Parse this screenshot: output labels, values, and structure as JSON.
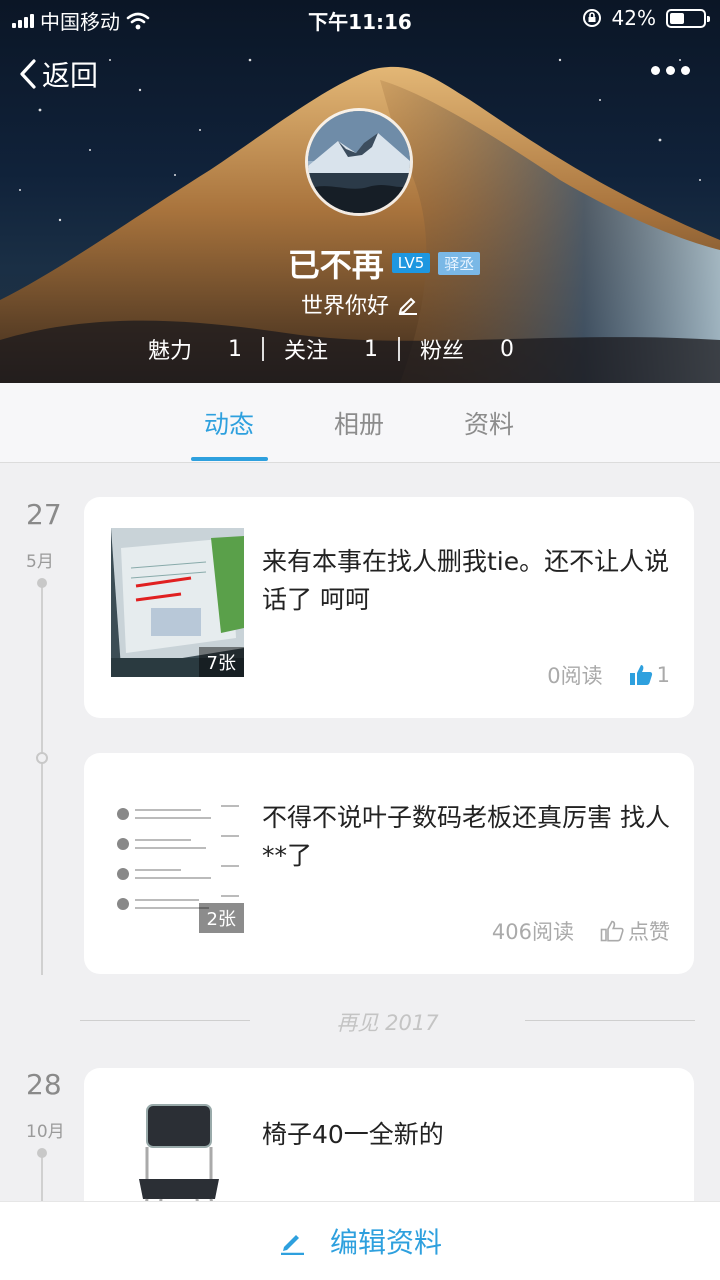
{
  "status_bar": {
    "carrier": "中国移动",
    "time": "下午11:16",
    "battery": "42%"
  },
  "nav": {
    "back_label": "返回"
  },
  "profile": {
    "username": "已不再",
    "level": "LV5",
    "badge": "驿丞",
    "signature": "世界你好",
    "stats": [
      {
        "label": "魅力",
        "value": "1"
      },
      {
        "label": "关注",
        "value": "1"
      },
      {
        "label": "粉丝",
        "value": "0"
      }
    ]
  },
  "tabs": [
    {
      "label": "动态",
      "active": true
    },
    {
      "label": "相册",
      "active": false
    },
    {
      "label": "资料",
      "active": false
    }
  ],
  "feed": {
    "posts": [
      {
        "day": "27",
        "month": "5月",
        "text": "来有本事在找人删我tie。还不让人说话了 呵呵",
        "image_count": "7张",
        "reads": "0阅读",
        "likes": "1"
      },
      {
        "day": "",
        "month": "",
        "text": "不得不说叶子数码老板还真厉害 找人**了",
        "image_count": "2张",
        "reads": "406阅读",
        "likes": "点赞"
      },
      {
        "day": "28",
        "month": "10月",
        "text": "椅子40一全新的",
        "image_count": "",
        "reads": "",
        "likes": ""
      }
    ],
    "year_divider": "再见 2017"
  },
  "bottom_bar": {
    "edit_label": "编辑资料"
  },
  "colors": {
    "accent": "#2ea0de",
    "level_badge": "#1e97e0"
  }
}
